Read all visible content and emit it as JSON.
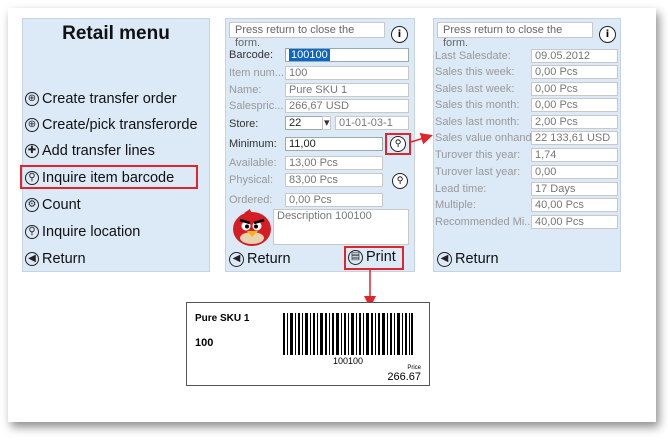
{
  "left_menu": {
    "title": "Retail menu",
    "items": [
      {
        "label": "Create transfer order",
        "icon": "plus-circle-icon",
        "glyph": "⊕"
      },
      {
        "label": "Create/pick transferorde",
        "icon": "plus-circle-icon",
        "glyph": "⊕"
      },
      {
        "label": "Add transfer lines",
        "icon": "add-circle-icon",
        "glyph": "✚"
      },
      {
        "label": "Inquire item barcode",
        "icon": "magnifier-icon",
        "glyph": "⚲"
      },
      {
        "label": "Count",
        "icon": "gear-icon",
        "glyph": "⚙"
      },
      {
        "label": "Inquire location",
        "icon": "magnifier-icon",
        "glyph": "⚲"
      },
      {
        "label": "Return",
        "icon": "back-arrow-icon",
        "glyph": "◀"
      }
    ],
    "highlight_color": "#e0262d"
  },
  "item_form": {
    "notice": "Press return to close the form.",
    "barcode_label": "Barcode:",
    "barcode_value": "100100",
    "item_number_label": "Item num...",
    "item_number_value": "100",
    "name_label": "Name:",
    "name_value": "Pure SKU 1",
    "sales_price_label": "Salespric...",
    "sales_price_value": "266,67 USD",
    "store_label": "Store:",
    "store_value": "22",
    "location_value": "01-01-03-1",
    "minimum_label": "Minimum:",
    "minimum_value": "11,00",
    "available_label": "Available:",
    "available_value": "13,00 Pcs",
    "physical_label": "Physical:",
    "physical_value": "83,00 Pcs",
    "ordered_label": "Ordered:",
    "ordered_value": "0,00 Pcs",
    "description_value": "Description 100100",
    "return_label": "Return",
    "print_label": "Print"
  },
  "sales_form": {
    "notice": "Press return to close the form.",
    "rows": [
      {
        "label": "Last Salesdate:",
        "value": "09.05.2012"
      },
      {
        "label": "Sales this week:",
        "value": "0,00 Pcs"
      },
      {
        "label": "Sales last week:",
        "value": "0,00 Pcs"
      },
      {
        "label": "Sales this month:",
        "value": "0,00 Pcs"
      },
      {
        "label": "Sales last month:",
        "value": "2,00 Pcs"
      },
      {
        "label": "Sales value onhand:",
        "value": "22 133,61 USD"
      },
      {
        "label": "Turover this year:",
        "value": "1,74"
      },
      {
        "label": "Turover last year:",
        "value": "0,00"
      },
      {
        "label": "Lead time:",
        "value": "17 Days"
      },
      {
        "label": "Multiple:",
        "value": "40,00 Pcs"
      },
      {
        "label": "Recommended Mi...",
        "value": "40,00 Pcs"
      }
    ],
    "return_label": "Return"
  },
  "print_label_card": {
    "product_name": "Pure SKU 1",
    "item_number": "100",
    "barcode_text": "100100",
    "price_caption": "Price",
    "price": "266.67"
  }
}
